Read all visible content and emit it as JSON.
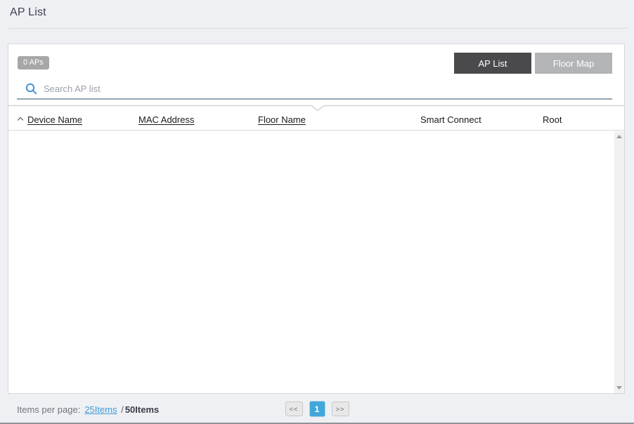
{
  "page": {
    "title": "AP List"
  },
  "panel": {
    "ap_count_badge": "0 APs",
    "view_toggle": {
      "ap_list_label": "AP List",
      "floor_map_label": "Floor Map",
      "active": "AP List"
    },
    "search": {
      "placeholder": "Search AP list",
      "value": ""
    },
    "table": {
      "columns": [
        {
          "label": "Device Name",
          "sortable": true,
          "sorted": "asc"
        },
        {
          "label": "MAC Address",
          "sortable": true,
          "sorted": null
        },
        {
          "label": "Floor Name",
          "sortable": true,
          "sorted": null
        },
        {
          "label": "Smart Connect",
          "sortable": false,
          "sorted": null
        },
        {
          "label": "Root",
          "sortable": false,
          "sorted": null
        }
      ],
      "rows": []
    }
  },
  "footer": {
    "items_per_page_label": "Items per page:",
    "separator": "/",
    "options": [
      {
        "label": "25Items",
        "selected": false
      },
      {
        "label": "50Items",
        "selected": true
      }
    ],
    "pagination": {
      "prev_label": "<<",
      "page": "1",
      "next_label": ">>"
    }
  },
  "colors": {
    "accent_blue": "#41a7da",
    "link_blue": "#3f9bd8",
    "search_icon_blue": "#4691d3",
    "active_tab_bg": "#4a4a4c",
    "inactive_tab_bg": "#b3b4b6",
    "badge_bg": "#a7a7a7",
    "page_bg": "#eef0f4",
    "search_underline": "#93a5b2"
  }
}
